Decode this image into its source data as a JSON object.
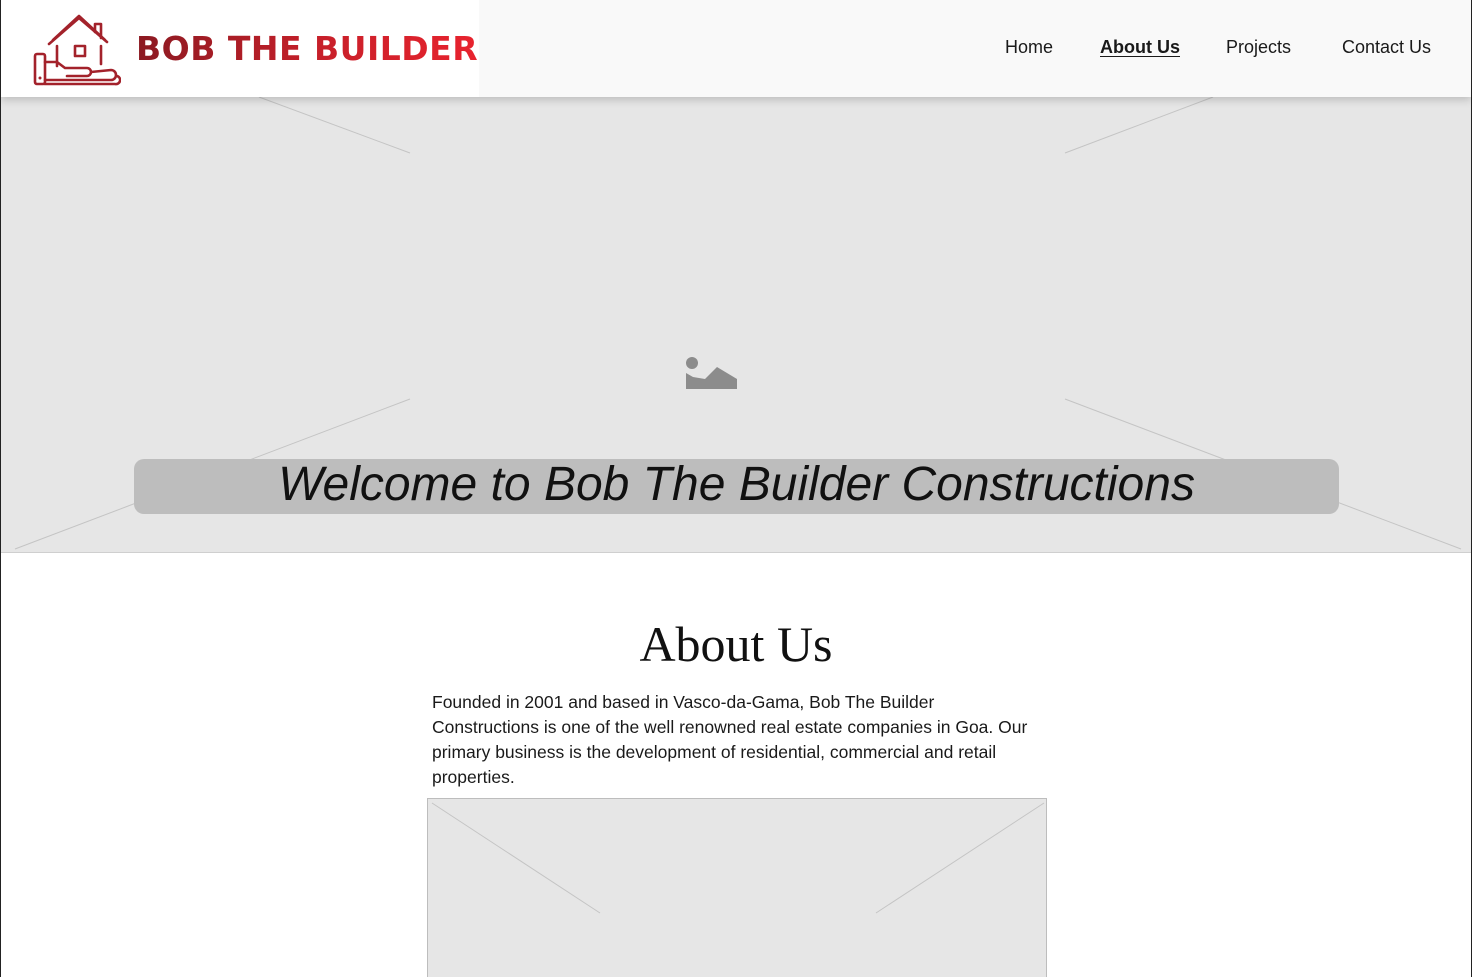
{
  "brand": {
    "name": "BOB THE BUILDER",
    "logo_icon": "house-in-hand-icon",
    "colors": {
      "dark_red": "#8b1a22",
      "red": "#e8232e"
    }
  },
  "nav": {
    "items": [
      {
        "label": "Home",
        "active": false
      },
      {
        "label": "About Us",
        "active": true
      },
      {
        "label": "Projects",
        "active": false
      },
      {
        "label": "Contact Us",
        "active": false
      }
    ]
  },
  "hero": {
    "image_icon": "image-placeholder-icon",
    "title": "Welcome to Bob The Builder Constructions"
  },
  "about": {
    "heading": "About Us",
    "body": "Founded in 2001 and based in Vasco-da-Gama, Bob The Builder Constructions is one of the well renowned real estate companies in Goa. Our primary business is the development of residential, commercial and retail properties.",
    "image": "image-placeholder"
  }
}
